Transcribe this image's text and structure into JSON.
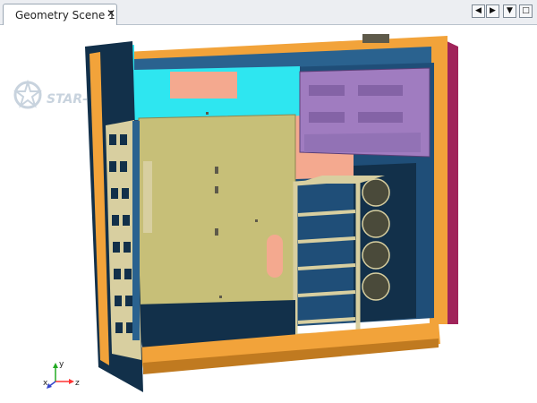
{
  "tab": {
    "title": "Geometry Scene 1",
    "close": "✕"
  },
  "controls": {
    "prev": "◀",
    "next": "▶",
    "menu": "▼",
    "restore": "□"
  },
  "logo": {
    "text": "STAR-C"
  },
  "triad": {
    "x": "x",
    "y": "y",
    "z": "z"
  },
  "colors": {
    "case_blue": "#1f4e78",
    "dark_navy": "#12304a",
    "orange": "#f2a33a",
    "cyan": "#2ee6f0",
    "panel_tan": "#c7bf78",
    "salmon": "#f4a98f",
    "purple": "#a07cc0",
    "maroon": "#a0245a",
    "cage_beige": "#d8cfa0"
  }
}
